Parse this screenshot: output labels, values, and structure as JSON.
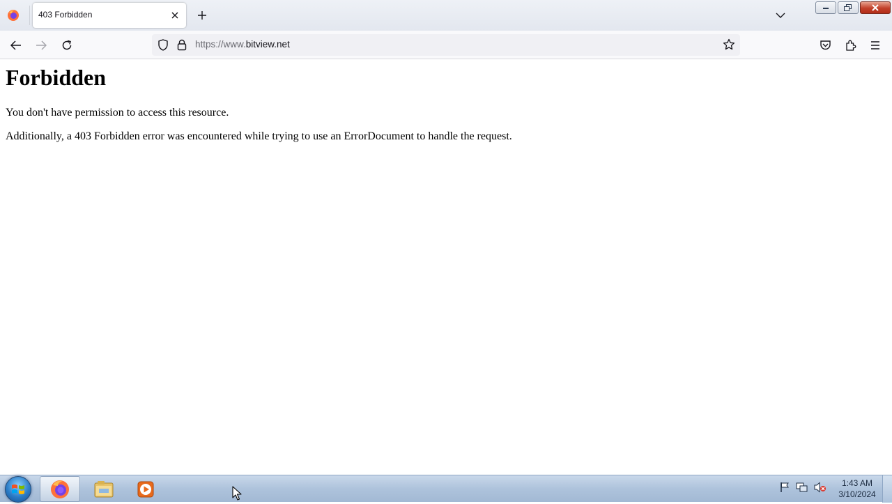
{
  "browser": {
    "tab": {
      "title": "403 Forbidden"
    },
    "url": {
      "prefix": "https://www.",
      "domain": "bitview.net"
    }
  },
  "page": {
    "heading": "Forbidden",
    "message": "You don't have permission to access this resource.",
    "detail": "Additionally, a 403 Forbidden error was encountered while trying to use an ErrorDocument to handle the request."
  },
  "taskbar": {
    "time": "1:43 AM",
    "date": "3/10/2024",
    "pinned": [
      "firefox-icon",
      "file-explorer-icon",
      "media-player-icon"
    ]
  },
  "colors": {
    "accent": "#0060df",
    "firefox_orange": "#ff7139",
    "firefox_purple": "#7542e5"
  }
}
